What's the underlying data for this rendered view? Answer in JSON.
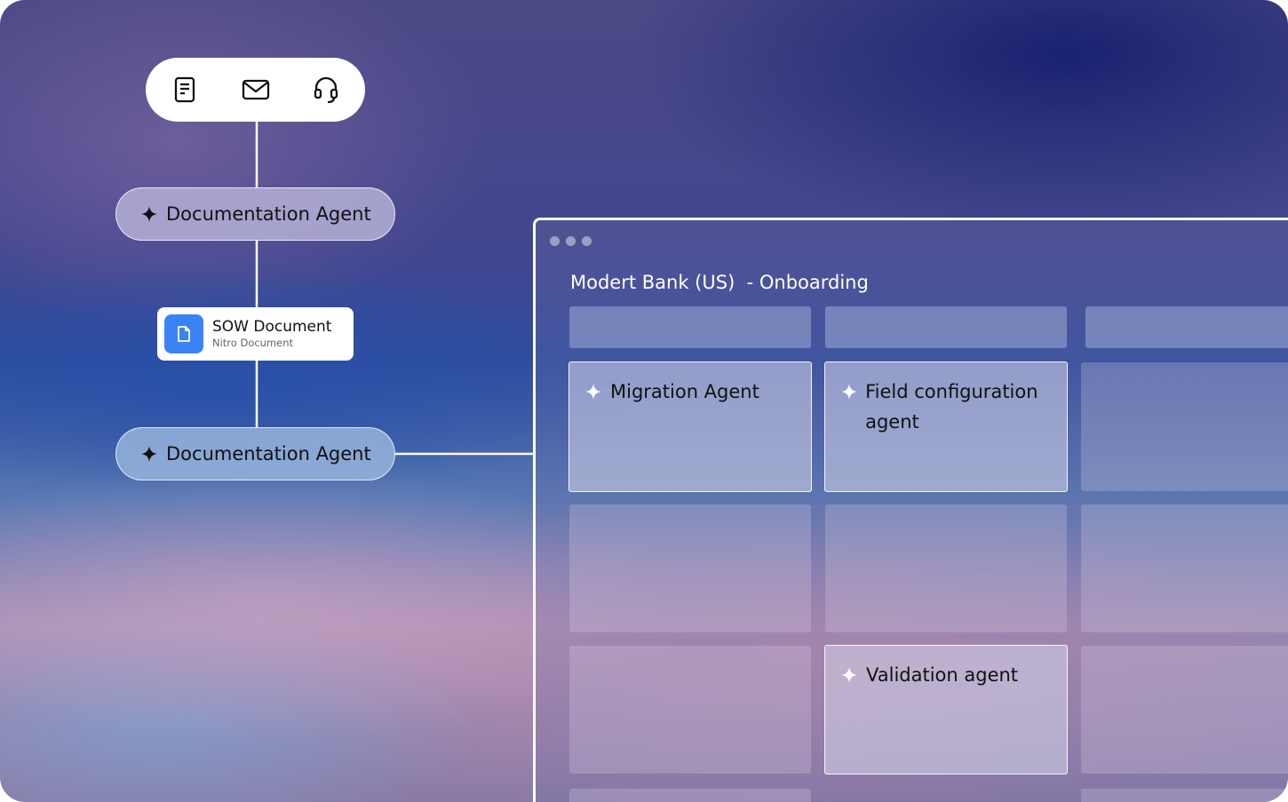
{
  "toolbar": {
    "icons": [
      "document-icon",
      "mail-icon",
      "headset-icon"
    ]
  },
  "flow": {
    "agent_top_label": "Documentation Agent",
    "sow_card": {
      "title": "SOW Document",
      "subtitle": "Nitro Document"
    },
    "agent_bottom_label": "Documentation Agent"
  },
  "window": {
    "title": "Modert Bank (US)  - Onboarding",
    "agents": {
      "migration": "Migration Agent",
      "field_config": "Field configuration agent",
      "validation": "Validation agent"
    }
  },
  "colors": {
    "accent_blue": "#3b82f6",
    "white": "#ffffff"
  }
}
